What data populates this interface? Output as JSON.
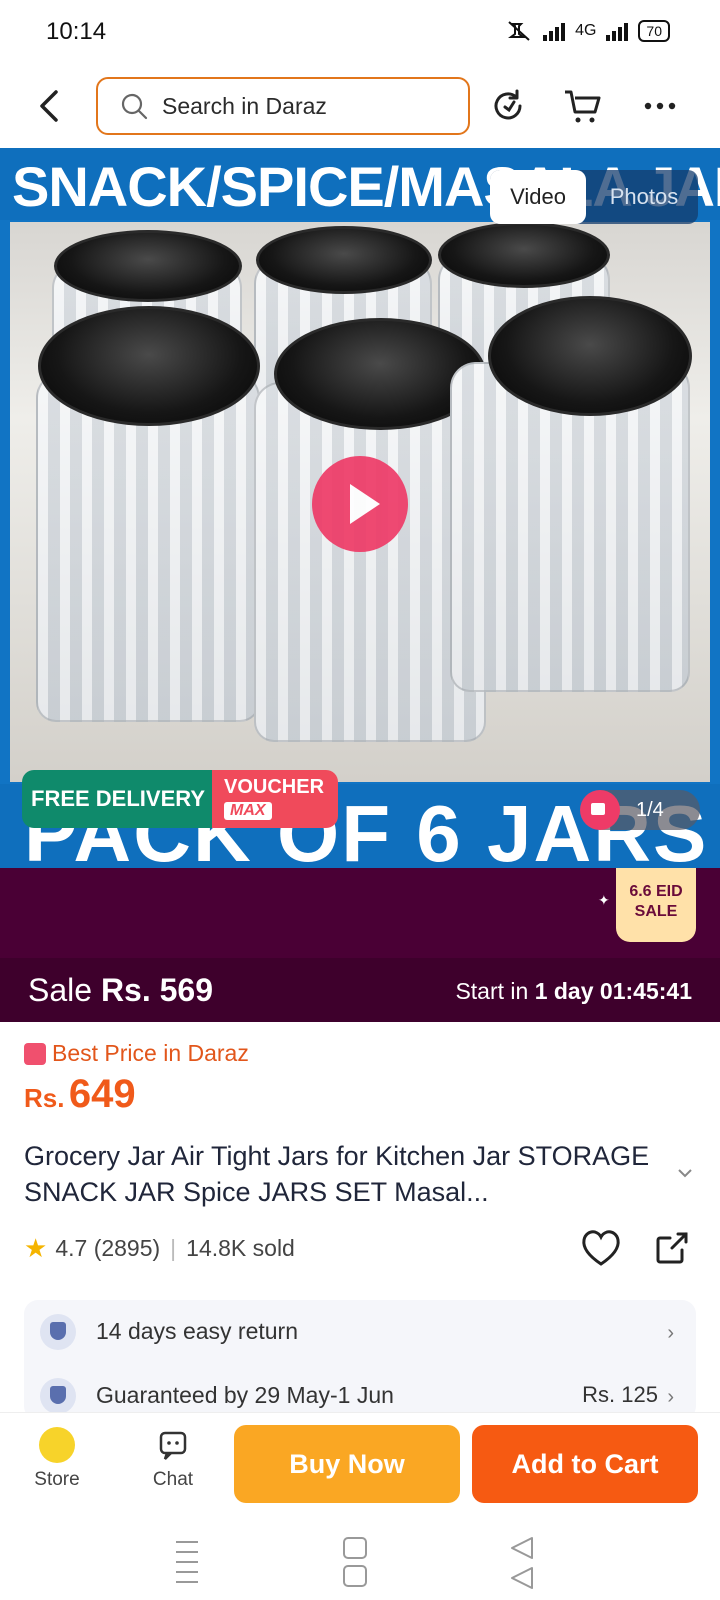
{
  "status": {
    "time": "10:14",
    "network": "4G",
    "battery": "70"
  },
  "search": {
    "placeholder": "Search in Daraz"
  },
  "hero": {
    "banner_top": "SNACK/SPICE/MASALA JAR",
    "banner_bottom": "PACK OF 6 JARS",
    "tabs": {
      "video": "Video",
      "photos": "Photos"
    },
    "tag_free": "FREE DELIVERY",
    "tag_voucher": "VOUCHER",
    "tag_voucher_sub": "MAX",
    "counter": "1/4"
  },
  "eid": {
    "line1": "6.6 EID",
    "line2": "SALE"
  },
  "sale": {
    "label": "Sale",
    "price": "Rs. 569",
    "start_prefix": "Start in",
    "start_days": "1 day",
    "start_time": "01:45:41"
  },
  "best_price": "Best Price in Daraz",
  "price": {
    "currency": "Rs.",
    "amount": "649"
  },
  "title": "Grocery Jar Air Tight Jars for Kitchen Jar STORAGE SNACK JAR Spice JARS SET Masal...",
  "rating": {
    "score": "4.7",
    "count": "(2895)",
    "sold": "14.8K sold"
  },
  "service": [
    {
      "text": "14 days easy return",
      "right": ""
    },
    {
      "text": "Guaranteed by 29 May-1 Jun",
      "right": "Rs. 125"
    }
  ],
  "bottom": {
    "store": "Store",
    "chat": "Chat",
    "buy": "Buy Now",
    "cart": "Add to Cart"
  },
  "colors": {
    "accent": "#f65a12",
    "buy": "#faa723",
    "sale_bg": "#3e002c"
  }
}
